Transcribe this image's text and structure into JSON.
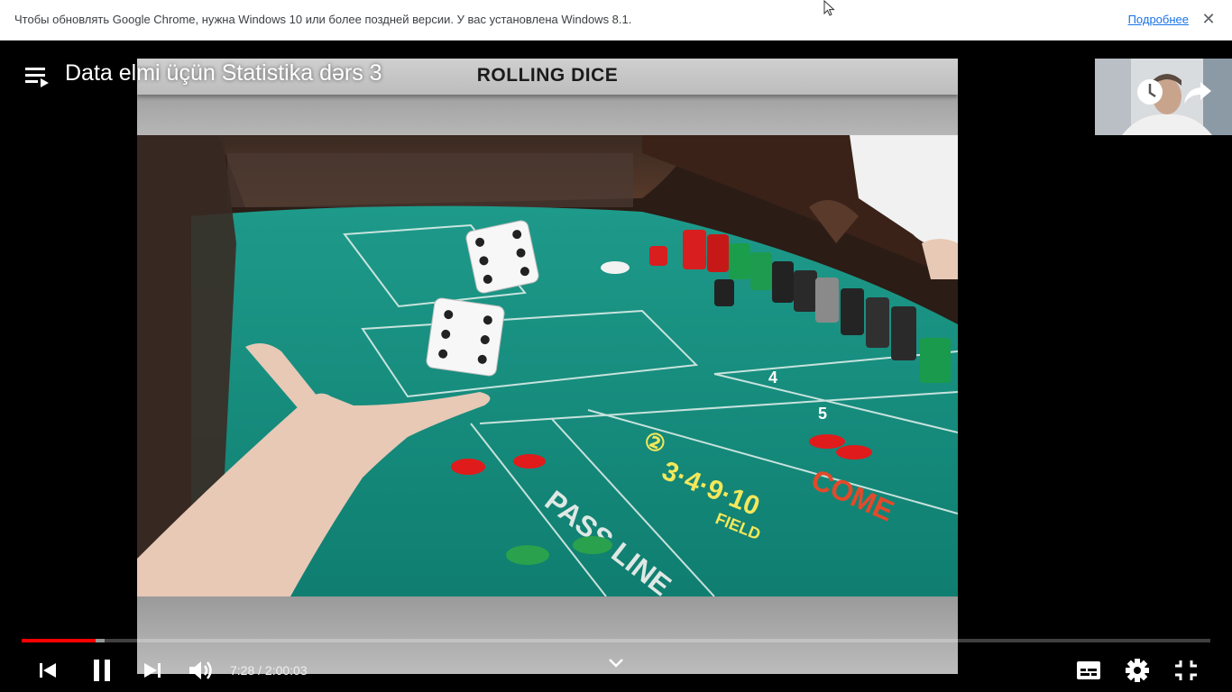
{
  "infobar": {
    "message": "Чтобы обновлять Google Chrome, нужна Windows 10 или более поздней версии. У вас установлена Windows 8.1.",
    "link": "Подробнее",
    "close": "✕"
  },
  "player": {
    "title": "Data elmi üçün Statistika dərs 3",
    "slide_title": "ROLLING DICE",
    "time_display": "7:28 / 2:00:03",
    "progress": {
      "played_fraction": 0.062,
      "loaded_fraction": 0.07
    }
  },
  "colors": {
    "progress_red": "#ff0000",
    "felt": "#148a7c",
    "link_blue": "#1a73e8"
  },
  "icons": [
    "playlist-icon",
    "clock-icon",
    "share-icon",
    "previous-icon",
    "pause-icon",
    "next-icon",
    "volume-icon",
    "chevron-down-icon",
    "subtitles-icon",
    "gear-icon",
    "exit-fullscreen-icon"
  ]
}
